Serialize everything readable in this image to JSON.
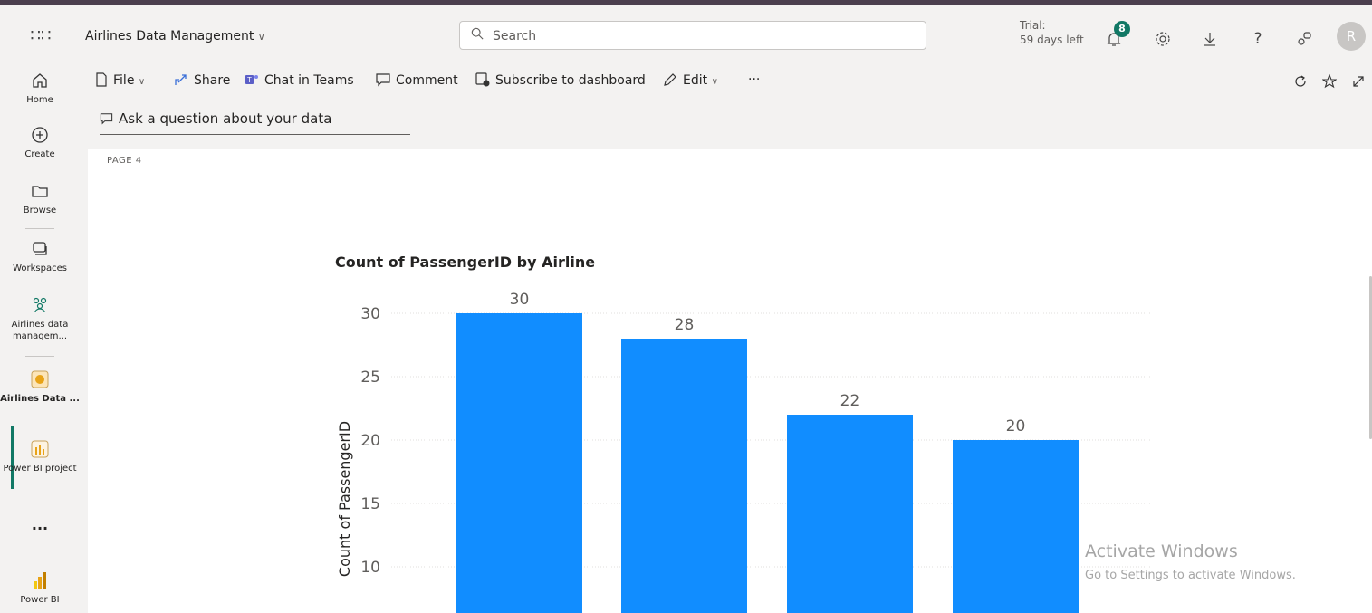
{
  "app": {
    "name": "Airlines Data Management",
    "search_placeholder": "Search",
    "trial_line1": "Trial:",
    "trial_line2": "59 days left",
    "notification_count": "8",
    "avatar_initial": "R"
  },
  "nav": {
    "items": [
      {
        "label": "Home",
        "icon": "home-icon"
      },
      {
        "label": "Create",
        "icon": "plus-circle-icon"
      },
      {
        "label": "Browse",
        "icon": "folder-icon"
      },
      {
        "label": "Workspaces",
        "icon": "workspaces-icon"
      },
      {
        "label": "Airlines data managem...",
        "icon": "people-group-icon"
      },
      {
        "label": "Airlines Data ...",
        "icon": "dashboard-icon"
      },
      {
        "label": "Power BI project",
        "icon": "report-icon"
      },
      {
        "label": "...",
        "icon": "more-icon"
      },
      {
        "label": "Power BI",
        "icon": "powerbi-logo"
      }
    ]
  },
  "commands": {
    "file": "File",
    "share": "Share",
    "chat": "Chat in Teams",
    "comment": "Comment",
    "subscribe": "Subscribe to dashboard",
    "edit": "Edit",
    "more": "···"
  },
  "ask_question": "Ask a question about your data",
  "page_label": "PAGE 4",
  "watermark": {
    "title": "Activate Windows",
    "subtitle": "Go to Settings to activate Windows."
  },
  "colors": {
    "bar": "#118dff",
    "active": "#117865"
  },
  "chart_data": {
    "type": "bar",
    "title": "Count of PassengerID by Airline",
    "ylabel": "Count of PassengerID",
    "xlabel": "",
    "values": [
      30,
      28,
      22,
      20
    ],
    "data_labels": [
      "30",
      "28",
      "22",
      "20"
    ],
    "yticks": [
      10,
      15,
      20,
      25,
      30
    ],
    "ylim": [
      5,
      32
    ],
    "grid": true
  }
}
